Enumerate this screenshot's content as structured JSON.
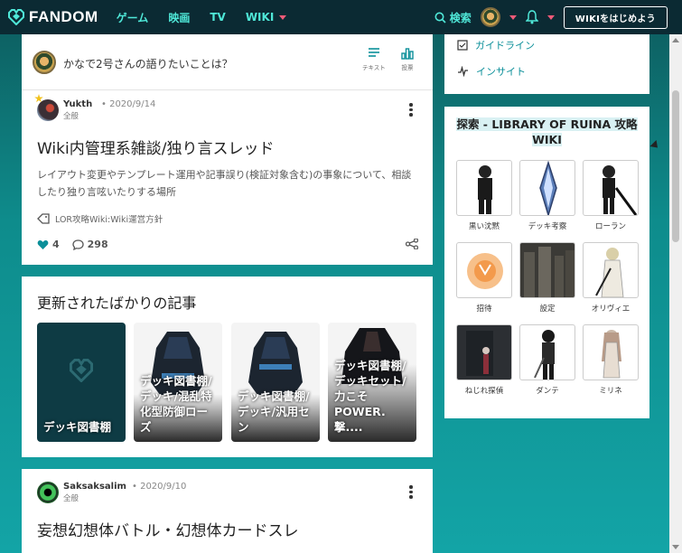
{
  "nav": {
    "logo": "FANDOM",
    "links": [
      "ゲーム",
      "映画",
      "TV",
      "WIKI"
    ],
    "search_label": "検索",
    "start_wiki": "WIKIをはじめよう"
  },
  "prompt": {
    "text": "かなで2号さんの語りたいことは？",
    "tools": [
      "テキスト",
      "投票"
    ]
  },
  "post1": {
    "user": "Yukth",
    "date": "• 2020/9/14",
    "category": "全般",
    "title": "Wiki内管理系雑談/独り言スレッド",
    "body": "レイアウト変更やテンプレート運用や記事誤り(検証対象含む)の事象について、相談したり独り言呟いたりする場所",
    "tag": "LOR攻略Wiki:Wiki運営方針",
    "likes": "4",
    "comments": "298"
  },
  "recent": {
    "title": "更新されたばかりの記事",
    "tiles": [
      "デッキ図書棚",
      "デッキ図書棚/デッキ/混乱特化型防御ローズ",
      "デッキ図書棚/デッキ/汎用セン",
      "デッキ図書棚/デッキセット/力こそPOWER.撃...."
    ]
  },
  "post2": {
    "user": "Saksaksalim",
    "date": "• 2020/9/10",
    "category": "全般",
    "title": "妄想幻想体バトル・幻想体カードスレ"
  },
  "sidebar": {
    "links": [
      "ガイドライン",
      "インサイト"
    ],
    "explore_title_line1": "探索 - LIBRARY OF RUINA 攻略",
    "explore_title_line2": "WIKI",
    "items": [
      "黒い沈黙",
      "デッキ考察",
      "ローラン",
      "招待",
      "設定",
      "オリヴィエ",
      "ねじれ探偵",
      "ダンテ",
      "ミリネ"
    ]
  },
  "colors": {
    "accent": "#0b8f99",
    "nav_bg": "#0b2a33",
    "nav_link": "#4fe8d8",
    "caret": "#f05a78"
  }
}
